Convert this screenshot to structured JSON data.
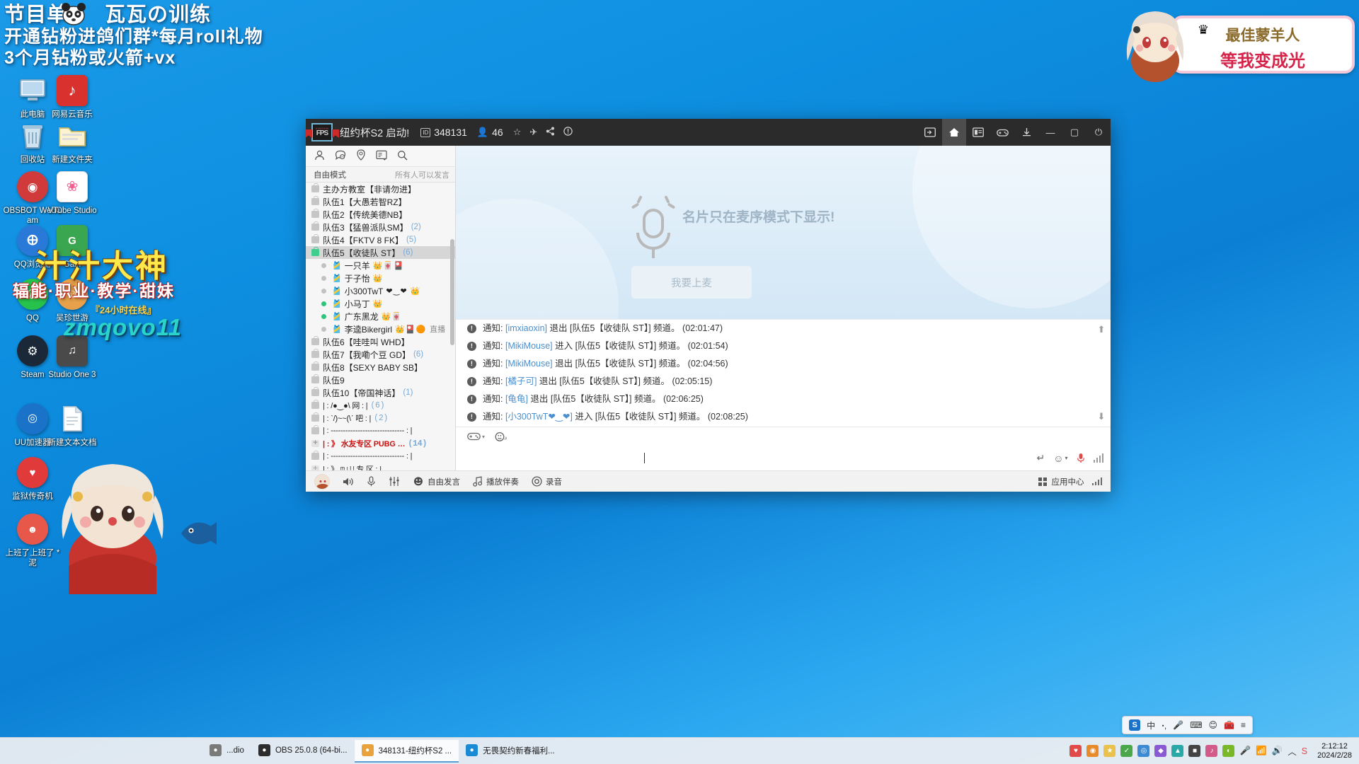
{
  "desktop": {
    "stream_title": {
      "line1": "节目单",
      "line2": "开通钻粉进鸽们群*每月roll礼物",
      "line3": "3个月钻粉或火箭+vx",
      "mascot_label": "瓦瓦の训练"
    },
    "watermark": {
      "line1": "汁汁大神",
      "line2": "辐能·职业·教学·甜妹",
      "line3": "『24小时在线』",
      "line4": "zmqovo11"
    },
    "icons": [
      {
        "label": "此电脑",
        "icon": "computer-icon"
      },
      {
        "label": "网易云音乐",
        "icon": "netease-music-icon"
      },
      {
        "label": "回收站",
        "icon": "recycle-bin-icon"
      },
      {
        "label": "新建文件夹",
        "icon": "folder-icon"
      },
      {
        "label": "OBSBOT WebCam",
        "icon": "obsbot-icon"
      },
      {
        "label": "VTube Studio",
        "icon": "vtube-studio-icon"
      },
      {
        "label": "QQ浏览器",
        "icon": "qq-browser-icon"
      },
      {
        "label": "Gain",
        "icon": "gain-icon"
      },
      {
        "label": "QQ",
        "icon": "qq-icon"
      },
      {
        "label": "吴珍世游",
        "icon": "app-icon"
      },
      {
        "label": "Steam",
        "icon": "steam-icon"
      },
      {
        "label": "Studio One 3",
        "icon": "studio-one-icon"
      },
      {
        "label": "UU加速器",
        "icon": "uu-booster-icon"
      },
      {
        "label": "新建文本文档",
        "icon": "text-file-icon"
      },
      {
        "label": "监狱传奇机",
        "icon": "app-icon"
      },
      {
        "label": "上班了上班了 *泥",
        "icon": "app-icon"
      }
    ]
  },
  "sticker": {
    "line1": "最佳蒙羊人",
    "line2": "等我变成光",
    "crown": "♛"
  },
  "app": {
    "logo": {
      "top": "XIAOXIN",
      "bottom": "FPS"
    },
    "title": "纽约杯S2 启动!",
    "id_badge": "ID",
    "id_value": "348131",
    "member_count": "46",
    "icons": {
      "star": "☆",
      "plane": "✈",
      "share": "share-icon",
      "info": "!"
    },
    "window_buttons": {
      "screen": "screen-icon",
      "home": "home-icon",
      "list": "list-icon",
      "game": "game-icon",
      "download": "download-icon",
      "minimize": "—",
      "maximize": "▢",
      "power": "⏻"
    },
    "left_pane": {
      "tools": [
        "person-icon",
        "chat-icon",
        "location-icon",
        "board-icon",
        "search-icon"
      ],
      "mode": "自由模式",
      "mode_right": "所有人可以发言",
      "channels": [
        {
          "type": "channel",
          "name": "主办方教室【非请勿进】",
          "count": "",
          "state": "locked"
        },
        {
          "type": "channel",
          "name": "队伍1【大愚若智RZ】",
          "count": "",
          "state": "locked"
        },
        {
          "type": "channel",
          "name": "队伍2【传统美德NB】",
          "count": "",
          "state": "locked"
        },
        {
          "type": "channel",
          "name": "队伍3【猛兽派队SM】",
          "count": "(2)",
          "state": "locked"
        },
        {
          "type": "channel",
          "name": "队伍4【FKTV 8  FK】",
          "count": "(5)",
          "state": "locked"
        },
        {
          "type": "channel",
          "name": "队伍5【收徒队  ST】",
          "count": "(6)",
          "state": "open",
          "selected": true
        },
        {
          "type": "member",
          "name": "一只羊",
          "badges": "👑🀄🎴",
          "online": false,
          "mic": "mic-off-icon"
        },
        {
          "type": "member",
          "name": "于子怡",
          "badges": "👑",
          "online": false,
          "mic": "mic-off-icon"
        },
        {
          "type": "member",
          "name": "小300TwT",
          "badges": "❤‿❤  👑",
          "online": false,
          "mic": "mic-off-icon"
        },
        {
          "type": "member",
          "name": "小马丁",
          "badges": "👑",
          "online": true,
          "mic": "mic-on-icon"
        },
        {
          "type": "member",
          "name": "广东黑龙",
          "badges": "👑🀄",
          "online": true,
          "mic": "mic-on-icon"
        },
        {
          "type": "member",
          "name": "李逵Bikergirl",
          "badges": "👑🎴🟠",
          "online": false,
          "mic": "mic-off-icon",
          "live": "直播"
        },
        {
          "type": "channel",
          "name": "队伍6【哇哇叫 WHD】",
          "count": "",
          "state": "locked"
        },
        {
          "type": "channel",
          "name": "队伍7【我嘞个豆 GD】",
          "count": "(6)",
          "state": "locked"
        },
        {
          "type": "channel",
          "name": "队伍8【SEXY BABY SB】",
          "count": "",
          "state": "locked"
        },
        {
          "type": "channel",
          "name": "队伍9",
          "count": "",
          "state": "locked"
        },
        {
          "type": "channel",
          "name": "队伍10【帝国神话】",
          "count": "(1)",
          "state": "locked"
        },
        {
          "type": "ascii",
          "name": "| :      /●‿●\\   网       : |",
          "count": "(6)",
          "state": "locked"
        },
        {
          "type": "ascii",
          "name": "| :      ˋ/)~~(\\ˊ   吧      : |",
          "count": "(2)",
          "state": "locked"
        },
        {
          "type": "ascii",
          "name": "| : ------------------------------  : |",
          "count": "",
          "state": "locked"
        },
        {
          "type": "ascii",
          "name": "| : 》   水友专区  PUBG  …",
          "count": "(14)",
          "state": "plus",
          "highlight": true
        },
        {
          "type": "ascii",
          "name": "| : ------------------------------  : |",
          "count": "",
          "state": "locked"
        },
        {
          "type": "ascii",
          "name": "| : 》 ᵐ   ᵎ ᴵ  ᴵ 专 区 : |",
          "count": "",
          "state": "plus"
        }
      ]
    },
    "card_panel": {
      "text": "名片只在麦序模式下显示!",
      "button": "我要上麦"
    },
    "messages": [
      {
        "label": "通知:",
        "user": "[imxiaoxin]",
        "action": "退出 [队伍5【收徒队  ST】] 频道。",
        "time": "(02:01:47)"
      },
      {
        "label": "通知:",
        "user": "[MikiMouse]",
        "action": "进入 [队伍5【收徒队  ST】] 频道。",
        "time": "(02:01:54)"
      },
      {
        "label": "通知:",
        "user": "[MikiMouse]",
        "action": "退出 [队伍5【收徒队  ST】] 频道。",
        "time": "(02:04:56)"
      },
      {
        "label": "通知:",
        "user": "[橘子可]",
        "action": "退出 [队伍5【收徒队  ST】] 频道。",
        "time": "(02:05:15)"
      },
      {
        "label": "通知:",
        "user": "[龟龟]",
        "action": "退出 [队伍5【收徒队  ST】] 频道。",
        "time": "(02:06:25)"
      },
      {
        "label": "通知:",
        "user": "[小300TwT❤‿❤]",
        "action": "进入 [队伍5【收徒队  ST】] 频道。",
        "time": "(02:08:25)"
      }
    ],
    "input": {
      "tools": [
        "game-controller-icon",
        "emoji-a-icon"
      ],
      "send_icon": "↵",
      "emoji_icon": "☺",
      "mic_icon": "mic-icon",
      "value": ""
    },
    "status_bar": {
      "avatar": "user-avatar",
      "speaker": "speaker-icon",
      "mic": "mic-icon",
      "mixer": "mixer-icon",
      "free_speak": "自由发言",
      "play_music": "播放伴奏",
      "record": "录音",
      "app_center": "应用中心"
    }
  },
  "taskbar": {
    "items": [
      {
        "label": "...dio",
        "icon": "studio-icon",
        "color": "#7a7a7a",
        "active": false
      },
      {
        "label": "OBS 25.0.8 (64-bi...",
        "icon": "obs-icon",
        "color": "#2d2d2d",
        "active": false
      },
      {
        "label": "348131-纽约杯S2 ...",
        "icon": "fps-icon",
        "color": "#e8a33d",
        "active": true
      },
      {
        "label": "无畏契约新春福利...",
        "icon": "browser-icon",
        "color": "#1a8ad4",
        "active": false
      }
    ],
    "clock_time": "2:12:12",
    "clock_date": "2024/2/28",
    "ime": {
      "logo": "S",
      "mode": "中",
      "punct": "ꞏ,"
    }
  }
}
